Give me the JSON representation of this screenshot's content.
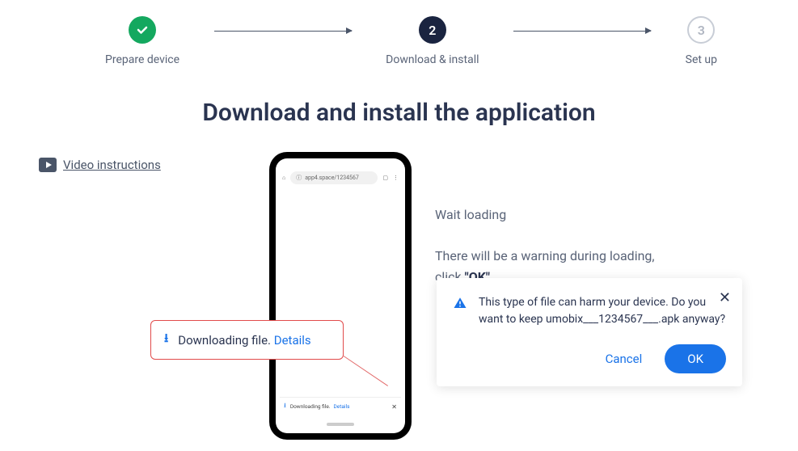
{
  "stepper": {
    "steps": [
      {
        "label": "Prepare device",
        "status": "complete"
      },
      {
        "label": "Download & install",
        "status": "active",
        "number": "2"
      },
      {
        "label": "Set up",
        "status": "pending",
        "number": "3"
      }
    ]
  },
  "page_title": "Download and install the application",
  "video_link_label": "Video instructions",
  "phone": {
    "url_text": "app4.space/1234567",
    "downloading_label": "Downloading file.",
    "details_label": "Details"
  },
  "callout": {
    "downloading_label": "Downloading file.",
    "details_label": "Details"
  },
  "instructions": {
    "line1": "Wait loading",
    "line2_prefix": "There will be a warning during loading, click ",
    "line2_bold": "\"OK\""
  },
  "warning_dialog": {
    "message": "This type of file can harm your device. Do you want to keep umobix___1234567___.apk anyway?",
    "cancel_label": "Cancel",
    "ok_label": "OK"
  }
}
